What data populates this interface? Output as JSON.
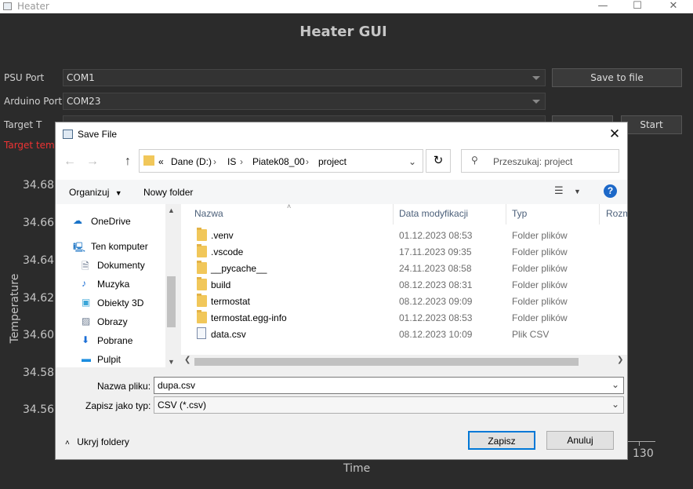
{
  "window": {
    "title": "Heater"
  },
  "app": {
    "title": "Heater GUI",
    "psu_label": "PSU Port",
    "psu_value": "COM1",
    "arduino_label": "Arduino Port",
    "arduino_value": "COM23",
    "target_label": "Target T",
    "save_button": "Save to file",
    "start_button": "Start",
    "target_warning": "Target temp"
  },
  "chart": {
    "y_ticks": [
      "34.68",
      "34.66",
      "34.64",
      "34.62",
      "34.60",
      "34.58",
      "34.56"
    ],
    "y_label": "Temperature",
    "x_label": "Time",
    "x_tick_visible": "130"
  },
  "dialog": {
    "title": "Save File",
    "breadcrumb": [
      "Dane (D:)",
      "IS",
      "Piatek08_00",
      "project"
    ],
    "breadcrumb_prefix": "«",
    "search_placeholder": "Przeszukaj: project",
    "organize_label": "Organizuj",
    "new_folder_label": "Nowy folder",
    "nav_items": [
      {
        "label": "OneDrive",
        "icon": "cloud-icon"
      },
      {
        "label": "Ten komputer",
        "icon": "computer-icon"
      },
      {
        "label": "Dokumenty",
        "icon": "documents-icon"
      },
      {
        "label": "Muzyka",
        "icon": "music-icon"
      },
      {
        "label": "Obiekty 3D",
        "icon": "cube-icon"
      },
      {
        "label": "Obrazy",
        "icon": "pictures-icon"
      },
      {
        "label": "Pobrane",
        "icon": "download-icon"
      },
      {
        "label": "Pulpit",
        "icon": "desktop-icon"
      }
    ],
    "columns": [
      "Nazwa",
      "Data modyfikacji",
      "Typ",
      "Rozm"
    ],
    "files": [
      {
        "name": ".venv",
        "date": "01.12.2023 08:53",
        "type": "Folder plików",
        "kind": "folder"
      },
      {
        "name": ".vscode",
        "date": "17.11.2023 09:35",
        "type": "Folder plików",
        "kind": "folder"
      },
      {
        "name": "__pycache__",
        "date": "24.11.2023 08:58",
        "type": "Folder plików",
        "kind": "folder"
      },
      {
        "name": "build",
        "date": "08.12.2023 08:31",
        "type": "Folder plików",
        "kind": "folder"
      },
      {
        "name": "termostat",
        "date": "08.12.2023 09:09",
        "type": "Folder plików",
        "kind": "folder"
      },
      {
        "name": "termostat.egg-info",
        "date": "01.12.2023 08:53",
        "type": "Folder plików",
        "kind": "folder"
      },
      {
        "name": "data.csv",
        "date": "08.12.2023 10:09",
        "type": "Plik CSV",
        "kind": "csv"
      }
    ],
    "filename_label": "Nazwa pliku:",
    "filename_value": "dupa.csv",
    "filetype_label": "Zapisz jako typ:",
    "filetype_value": "CSV (*.csv)",
    "hide_folders_label": "Ukryj foldery",
    "save_button": "Zapisz",
    "cancel_button": "Anuluj",
    "accent": "#0078d7"
  }
}
